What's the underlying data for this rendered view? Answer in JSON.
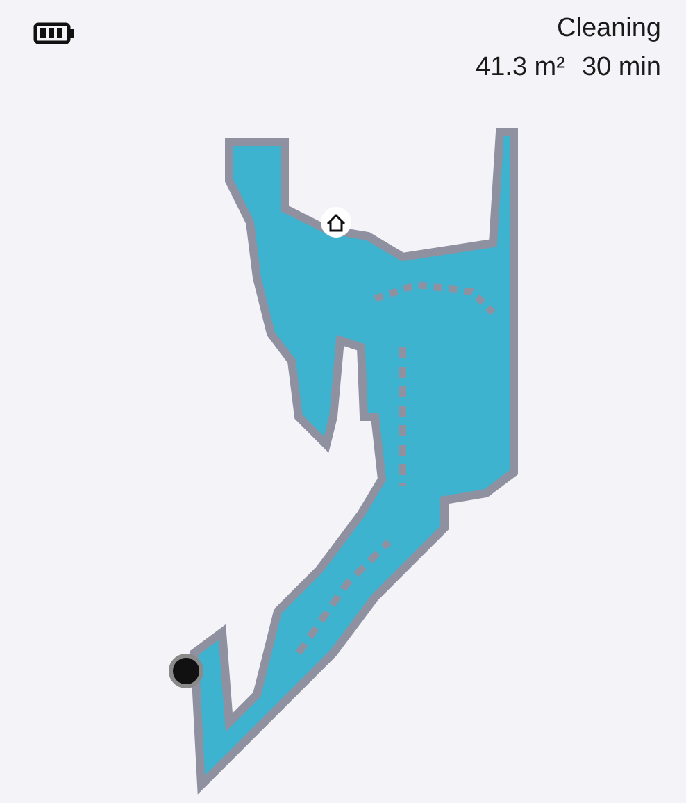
{
  "status": {
    "state": "Cleaning",
    "area": "41.3 m²",
    "duration": "30 min"
  }
}
